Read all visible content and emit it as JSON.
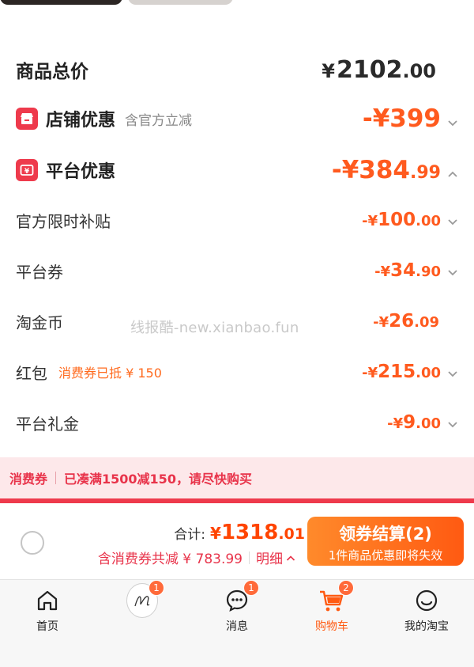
{
  "summary": {
    "total_label": "商品总价",
    "total_currency": "¥",
    "total_integer": "2102",
    "total_decimal": ".00"
  },
  "shop_discount": {
    "title": "店铺优惠",
    "subtitle": "含官方立减",
    "amount_prefix": "-¥",
    "amount_integer": "399",
    "amount_decimal": ""
  },
  "platform_discount": {
    "title": "平台优惠",
    "amount_prefix": "-¥",
    "amount_integer": "384",
    "amount_decimal": ".99",
    "items": [
      {
        "label": "官方限时补贴",
        "sub": "",
        "prefix": "-¥",
        "integer": "100",
        "decimal": ".00",
        "chevron": true
      },
      {
        "label": "平台券",
        "sub": "",
        "prefix": "-¥",
        "integer": "34",
        "decimal": ".90",
        "chevron": true
      },
      {
        "label": "淘金币",
        "sub": "",
        "prefix": "-¥",
        "integer": "26",
        "decimal": ".09",
        "chevron": false
      },
      {
        "label": "红包",
        "sub": "消费券已抵 ¥ 150",
        "prefix": "-¥",
        "integer": "215",
        "decimal": ".00",
        "chevron": true
      },
      {
        "label": "平台礼金",
        "sub": "",
        "prefix": "-¥",
        "integer": "9",
        "decimal": ".00",
        "chevron": true
      }
    ]
  },
  "watermark": "线报酷-new.xianbao.fun",
  "coupon_bar": {
    "tag": "消费券",
    "text": "已凑满1500减150，请尽快购买"
  },
  "checkout": {
    "sum_label": "合计:",
    "sum_currency": "¥",
    "sum_integer": "1318",
    "sum_decimal": ".01",
    "saved_text": "含消费券共减 ¥ 783.99",
    "detail_label": "明细",
    "button_main": "领券结算(2)",
    "button_sub": "1件商品优惠即将失效"
  },
  "tabbar": {
    "tabs": [
      {
        "label": "首页",
        "icon": "home-icon",
        "badge": ""
      },
      {
        "label": "",
        "icon": "avatar-icon",
        "badge": "1"
      },
      {
        "label": "消息",
        "icon": "message-icon",
        "badge": "1"
      },
      {
        "label": "购物车",
        "icon": "cart-icon",
        "badge": "2"
      },
      {
        "label": "我的淘宝",
        "icon": "profile-icon",
        "badge": ""
      }
    ],
    "active_color": "#ff5a12"
  },
  "colors": {
    "accent": "#ff5a1e",
    "red": "#ee3a4c",
    "coupon_bg": "#fde8ea"
  }
}
